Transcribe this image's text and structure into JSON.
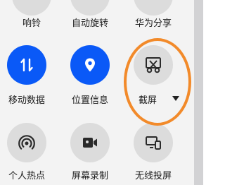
{
  "row1": [
    {
      "label": "响铃"
    },
    {
      "label": "自动旋转"
    },
    {
      "label": "华为分享"
    }
  ],
  "row2": [
    {
      "label": "移动数据",
      "icon": "mobile-data-icon",
      "state": "on"
    },
    {
      "label": "位置信息",
      "icon": "location-icon",
      "state": "on"
    },
    {
      "label": "截屏",
      "icon": "screenshot-icon",
      "state": "off",
      "has_menu": true
    }
  ],
  "row3": [
    {
      "label": "个人热点",
      "icon": "hotspot-icon"
    },
    {
      "label": "屏幕录制",
      "icon": "screen-record-icon"
    },
    {
      "label": "无线投屏",
      "icon": "wireless-projection-icon"
    }
  ],
  "colors": {
    "accent": "#0a59f7",
    "annotation": "#f28a2a"
  }
}
